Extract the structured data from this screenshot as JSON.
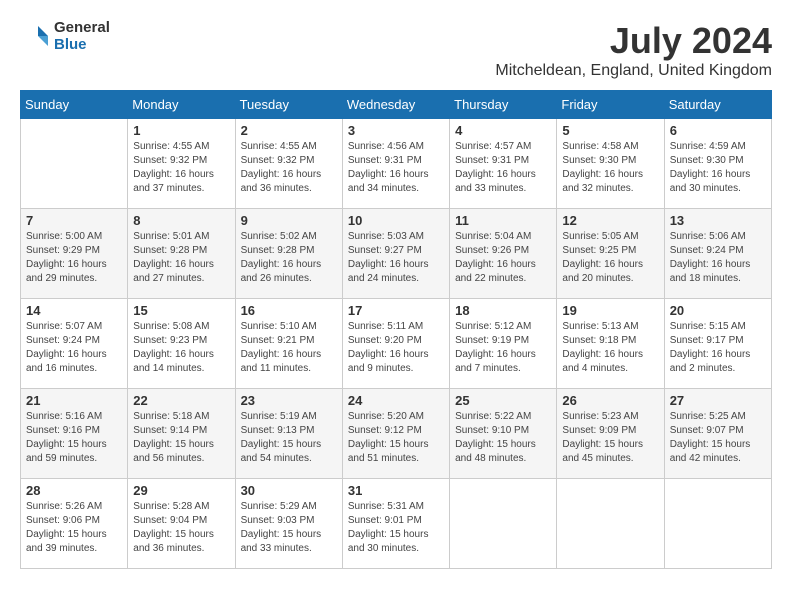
{
  "logo": {
    "general": "General",
    "blue": "Blue"
  },
  "title": "July 2024",
  "location": "Mitcheldean, England, United Kingdom",
  "days_of_week": [
    "Sunday",
    "Monday",
    "Tuesday",
    "Wednesday",
    "Thursday",
    "Friday",
    "Saturday"
  ],
  "weeks": [
    [
      {
        "day": "",
        "info": ""
      },
      {
        "day": "1",
        "info": "Sunrise: 4:55 AM\nSunset: 9:32 PM\nDaylight: 16 hours\nand 37 minutes."
      },
      {
        "day": "2",
        "info": "Sunrise: 4:55 AM\nSunset: 9:32 PM\nDaylight: 16 hours\nand 36 minutes."
      },
      {
        "day": "3",
        "info": "Sunrise: 4:56 AM\nSunset: 9:31 PM\nDaylight: 16 hours\nand 34 minutes."
      },
      {
        "day": "4",
        "info": "Sunrise: 4:57 AM\nSunset: 9:31 PM\nDaylight: 16 hours\nand 33 minutes."
      },
      {
        "day": "5",
        "info": "Sunrise: 4:58 AM\nSunset: 9:30 PM\nDaylight: 16 hours\nand 32 minutes."
      },
      {
        "day": "6",
        "info": "Sunrise: 4:59 AM\nSunset: 9:30 PM\nDaylight: 16 hours\nand 30 minutes."
      }
    ],
    [
      {
        "day": "7",
        "info": "Sunrise: 5:00 AM\nSunset: 9:29 PM\nDaylight: 16 hours\nand 29 minutes."
      },
      {
        "day": "8",
        "info": "Sunrise: 5:01 AM\nSunset: 9:28 PM\nDaylight: 16 hours\nand 27 minutes."
      },
      {
        "day": "9",
        "info": "Sunrise: 5:02 AM\nSunset: 9:28 PM\nDaylight: 16 hours\nand 26 minutes."
      },
      {
        "day": "10",
        "info": "Sunrise: 5:03 AM\nSunset: 9:27 PM\nDaylight: 16 hours\nand 24 minutes."
      },
      {
        "day": "11",
        "info": "Sunrise: 5:04 AM\nSunset: 9:26 PM\nDaylight: 16 hours\nand 22 minutes."
      },
      {
        "day": "12",
        "info": "Sunrise: 5:05 AM\nSunset: 9:25 PM\nDaylight: 16 hours\nand 20 minutes."
      },
      {
        "day": "13",
        "info": "Sunrise: 5:06 AM\nSunset: 9:24 PM\nDaylight: 16 hours\nand 18 minutes."
      }
    ],
    [
      {
        "day": "14",
        "info": "Sunrise: 5:07 AM\nSunset: 9:24 PM\nDaylight: 16 hours\nand 16 minutes."
      },
      {
        "day": "15",
        "info": "Sunrise: 5:08 AM\nSunset: 9:23 PM\nDaylight: 16 hours\nand 14 minutes."
      },
      {
        "day": "16",
        "info": "Sunrise: 5:10 AM\nSunset: 9:21 PM\nDaylight: 16 hours\nand 11 minutes."
      },
      {
        "day": "17",
        "info": "Sunrise: 5:11 AM\nSunset: 9:20 PM\nDaylight: 16 hours\nand 9 minutes."
      },
      {
        "day": "18",
        "info": "Sunrise: 5:12 AM\nSunset: 9:19 PM\nDaylight: 16 hours\nand 7 minutes."
      },
      {
        "day": "19",
        "info": "Sunrise: 5:13 AM\nSunset: 9:18 PM\nDaylight: 16 hours\nand 4 minutes."
      },
      {
        "day": "20",
        "info": "Sunrise: 5:15 AM\nSunset: 9:17 PM\nDaylight: 16 hours\nand 2 minutes."
      }
    ],
    [
      {
        "day": "21",
        "info": "Sunrise: 5:16 AM\nSunset: 9:16 PM\nDaylight: 15 hours\nand 59 minutes."
      },
      {
        "day": "22",
        "info": "Sunrise: 5:18 AM\nSunset: 9:14 PM\nDaylight: 15 hours\nand 56 minutes."
      },
      {
        "day": "23",
        "info": "Sunrise: 5:19 AM\nSunset: 9:13 PM\nDaylight: 15 hours\nand 54 minutes."
      },
      {
        "day": "24",
        "info": "Sunrise: 5:20 AM\nSunset: 9:12 PM\nDaylight: 15 hours\nand 51 minutes."
      },
      {
        "day": "25",
        "info": "Sunrise: 5:22 AM\nSunset: 9:10 PM\nDaylight: 15 hours\nand 48 minutes."
      },
      {
        "day": "26",
        "info": "Sunrise: 5:23 AM\nSunset: 9:09 PM\nDaylight: 15 hours\nand 45 minutes."
      },
      {
        "day": "27",
        "info": "Sunrise: 5:25 AM\nSunset: 9:07 PM\nDaylight: 15 hours\nand 42 minutes."
      }
    ],
    [
      {
        "day": "28",
        "info": "Sunrise: 5:26 AM\nSunset: 9:06 PM\nDaylight: 15 hours\nand 39 minutes."
      },
      {
        "day": "29",
        "info": "Sunrise: 5:28 AM\nSunset: 9:04 PM\nDaylight: 15 hours\nand 36 minutes."
      },
      {
        "day": "30",
        "info": "Sunrise: 5:29 AM\nSunset: 9:03 PM\nDaylight: 15 hours\nand 33 minutes."
      },
      {
        "day": "31",
        "info": "Sunrise: 5:31 AM\nSunset: 9:01 PM\nDaylight: 15 hours\nand 30 minutes."
      },
      {
        "day": "",
        "info": ""
      },
      {
        "day": "",
        "info": ""
      },
      {
        "day": "",
        "info": ""
      }
    ]
  ]
}
